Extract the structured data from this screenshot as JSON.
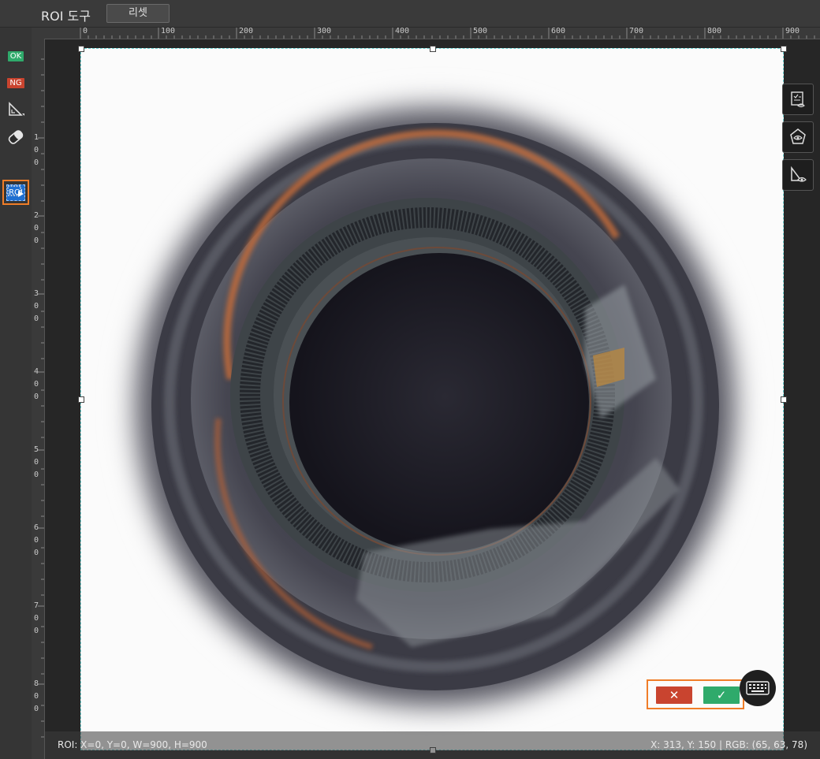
{
  "header": {
    "title": "ROI 도구",
    "reset_label": "리셋"
  },
  "left_toolbar": {
    "ok_label": "OK",
    "ng_label": "NG",
    "roi_label": "ROI",
    "icons": [
      "ok-tag",
      "ng-tag",
      "ruler-triangle-icon",
      "eraser-icon",
      "roi-select-icon",
      "roi-play-icon"
    ]
  },
  "rulers": {
    "horizontal": [
      "0",
      "100",
      "200",
      "300",
      "400",
      "500",
      "600",
      "700",
      "800",
      "900"
    ],
    "vertical": [
      [
        "1",
        "0",
        "0"
      ],
      [
        "2",
        "0",
        "0"
      ],
      [
        "3",
        "0",
        "0"
      ],
      [
        "4",
        "0",
        "0"
      ],
      [
        "5",
        "0",
        "0"
      ],
      [
        "6",
        "0",
        "0"
      ],
      [
        "7",
        "0",
        "0"
      ],
      [
        "8",
        "0",
        "0"
      ]
    ]
  },
  "right_tools": [
    "checklist-eye-icon",
    "pentagon-eye-icon",
    "ruler-eye-icon"
  ],
  "actions": {
    "cancel_label": "✕",
    "confirm_label": "✓"
  },
  "status": {
    "roi": "ROI: X=0, Y=0, W=900, H=900",
    "cursor": "X: 313, Y: 150 | RGB: (65, 63, 78)"
  },
  "colors": {
    "accent_orange": "#f07d28",
    "ok_green": "#2faa6b",
    "ng_red": "#c9442f",
    "roi_blue": "#1f6fd1"
  }
}
